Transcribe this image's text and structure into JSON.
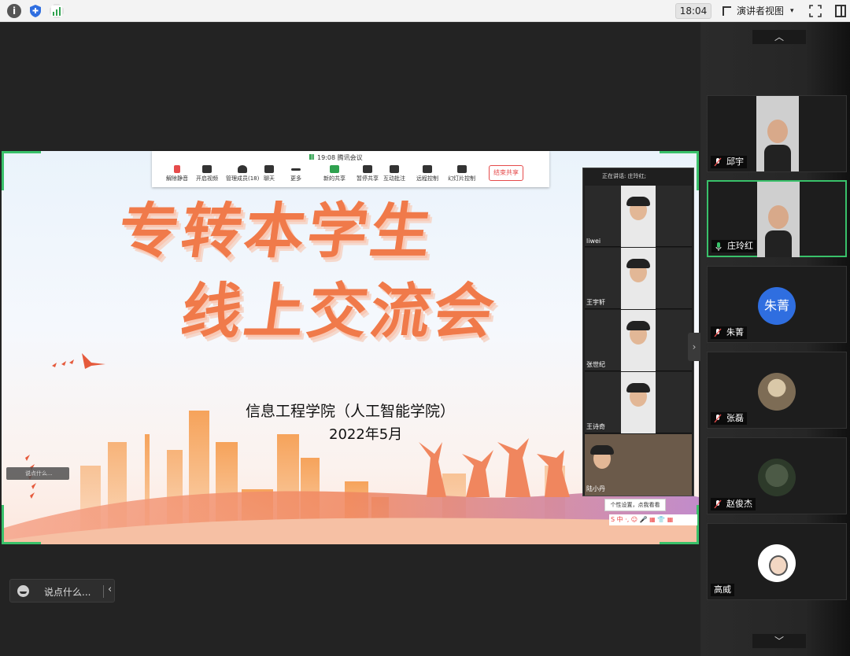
{
  "topbar": {
    "time": "18:04",
    "view_label": "演讲者视图",
    "caret": "▾"
  },
  "slide": {
    "title_line1": "专转本学生",
    "title_line2": "线上交流会",
    "subtitle": "信息工程学院（人工智能学院）",
    "date": "2022年5月"
  },
  "meeting_toolbar": {
    "time": "19:08",
    "app_name": "腾讯会议",
    "buttons": [
      "解除静音",
      "开启视频",
      "管理成员(18)",
      "聊天",
      "更多",
      "新的共享",
      "暂停共享",
      "互动批注",
      "远程控制",
      "幻灯片控制"
    ],
    "end_share": "结束共享"
  },
  "video_strip": {
    "speaking": "正在讲话: 庄玲红;",
    "tiles": [
      "liwei",
      "王宇轩",
      "张世纪",
      "王诗奇",
      "陆小丹"
    ]
  },
  "slide_overlay": {
    "chat_mini": "说点什么...",
    "tip": "个性设置，点我看看",
    "ime": "S 中 ·, ☺ 🎤 ▦ 👕 ▦"
  },
  "chatbox": {
    "placeholder": "说点什么..."
  },
  "participants": [
    {
      "name": "邱宇",
      "kind": "video"
    },
    {
      "name": "庄玲红",
      "kind": "video",
      "active": true
    },
    {
      "name": "朱菁",
      "kind": "avatar",
      "avatar_text": "朱菁"
    },
    {
      "name": "张磊",
      "kind": "photo"
    },
    {
      "name": "赵俊杰",
      "kind": "photo"
    },
    {
      "name": "高威",
      "kind": "photo"
    }
  ],
  "colors": {
    "active_border": "#39c16a",
    "title": "#f07a4a",
    "avatar_blue": "#2f6ee0",
    "end_share": "#e64b4b"
  }
}
